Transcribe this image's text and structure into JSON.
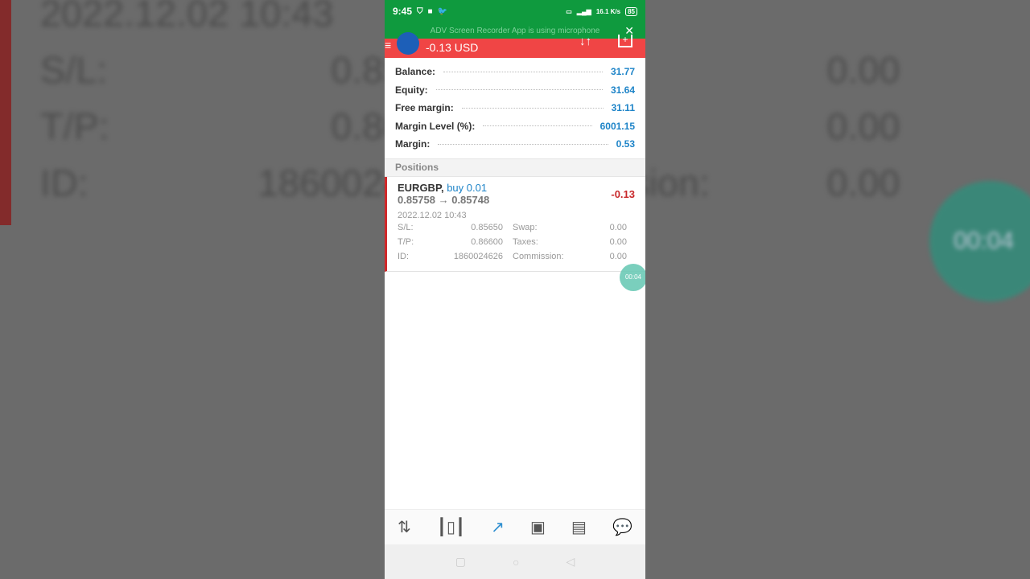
{
  "status_bar": {
    "time": "9:45",
    "speed": "16.1 K/s",
    "battery": "85"
  },
  "notification": {
    "text": "ADV Screen Recorder App is using microphone"
  },
  "header": {
    "profit": "-0.13 USD"
  },
  "account": [
    {
      "label": "Balance:",
      "value": "31.77"
    },
    {
      "label": "Equity:",
      "value": "31.64"
    },
    {
      "label": "Free margin:",
      "value": "31.11"
    },
    {
      "label": "Margin Level (%):",
      "value": "6001.15"
    },
    {
      "label": "Margin:",
      "value": "0.53"
    }
  ],
  "positions": {
    "title": "Positions",
    "items": [
      {
        "symbol": "EURGBP,",
        "side": "buy 0.01",
        "prices": "0.85758 → 0.85748",
        "profit": "-0.13",
        "date": "2022.12.02 10:43",
        "sl_label": "S/L:",
        "sl": "0.85650",
        "swap_label": "Swap:",
        "swap": "0.00",
        "tp_label": "T/P:",
        "tp": "0.86600",
        "taxes_label": "Taxes:",
        "taxes": "0.00",
        "id_label": "ID:",
        "id": "1860024626",
        "commission_label": "Commission:",
        "commission": "0.00"
      }
    ]
  },
  "recording_timer": "00:04",
  "tabs": [
    {
      "icon": "quotes-icon"
    },
    {
      "icon": "chart-icon"
    },
    {
      "icon": "trade-icon",
      "active": true
    },
    {
      "icon": "history-icon"
    },
    {
      "icon": "news-icon"
    },
    {
      "icon": "chat-icon"
    }
  ],
  "colors": {
    "status_green": "#0f9a3e",
    "header_red": "#f04545",
    "value_blue": "#1e84c8",
    "loss_red": "#c8282a"
  }
}
